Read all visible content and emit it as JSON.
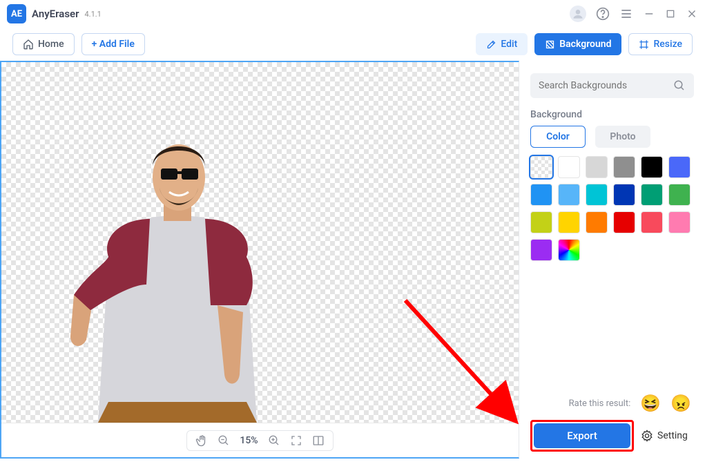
{
  "app": {
    "name": "AnyEraser",
    "version": "4.1.1"
  },
  "toolbar": {
    "home": "Home",
    "add_file": "+ Add File",
    "edit": "Edit",
    "background": "Background",
    "resize": "Resize"
  },
  "canvas_controls": {
    "zoom_level": "15%"
  },
  "sidebar": {
    "search_placeholder": "Search Backgrounds",
    "section_label": "Background",
    "tabs": {
      "color": "Color",
      "photo": "Photo"
    },
    "swatches": [
      {
        "type": "checker",
        "selected": true
      },
      {
        "type": "solid",
        "color": "#ffffff"
      },
      {
        "type": "solid",
        "color": "#d7d7d7"
      },
      {
        "type": "solid",
        "color": "#8f8f8f"
      },
      {
        "type": "solid",
        "color": "#000000"
      },
      {
        "type": "solid",
        "color": "#4a68f9"
      },
      {
        "type": "solid",
        "color": "#2093f3"
      },
      {
        "type": "solid",
        "color": "#57b5f9"
      },
      {
        "type": "solid",
        "color": "#00c4d6"
      },
      {
        "type": "solid",
        "color": "#0036b4"
      },
      {
        "type": "solid",
        "color": "#009e74"
      },
      {
        "type": "solid",
        "color": "#3fb24f"
      },
      {
        "type": "solid",
        "color": "#c3d117"
      },
      {
        "type": "solid",
        "color": "#ffd400"
      },
      {
        "type": "solid",
        "color": "#ff7b00"
      },
      {
        "type": "solid",
        "color": "#e60000"
      },
      {
        "type": "solid",
        "color": "#f84a5c"
      },
      {
        "type": "solid",
        "color": "#ff7bb0"
      },
      {
        "type": "solid",
        "color": "#9b2cf2"
      },
      {
        "type": "rainbow"
      }
    ]
  },
  "rating": {
    "label": "Rate this result:"
  },
  "actions": {
    "export": "Export",
    "setting": "Setting"
  },
  "colors": {
    "accent": "#2376e5",
    "annotation": "#f00000"
  }
}
